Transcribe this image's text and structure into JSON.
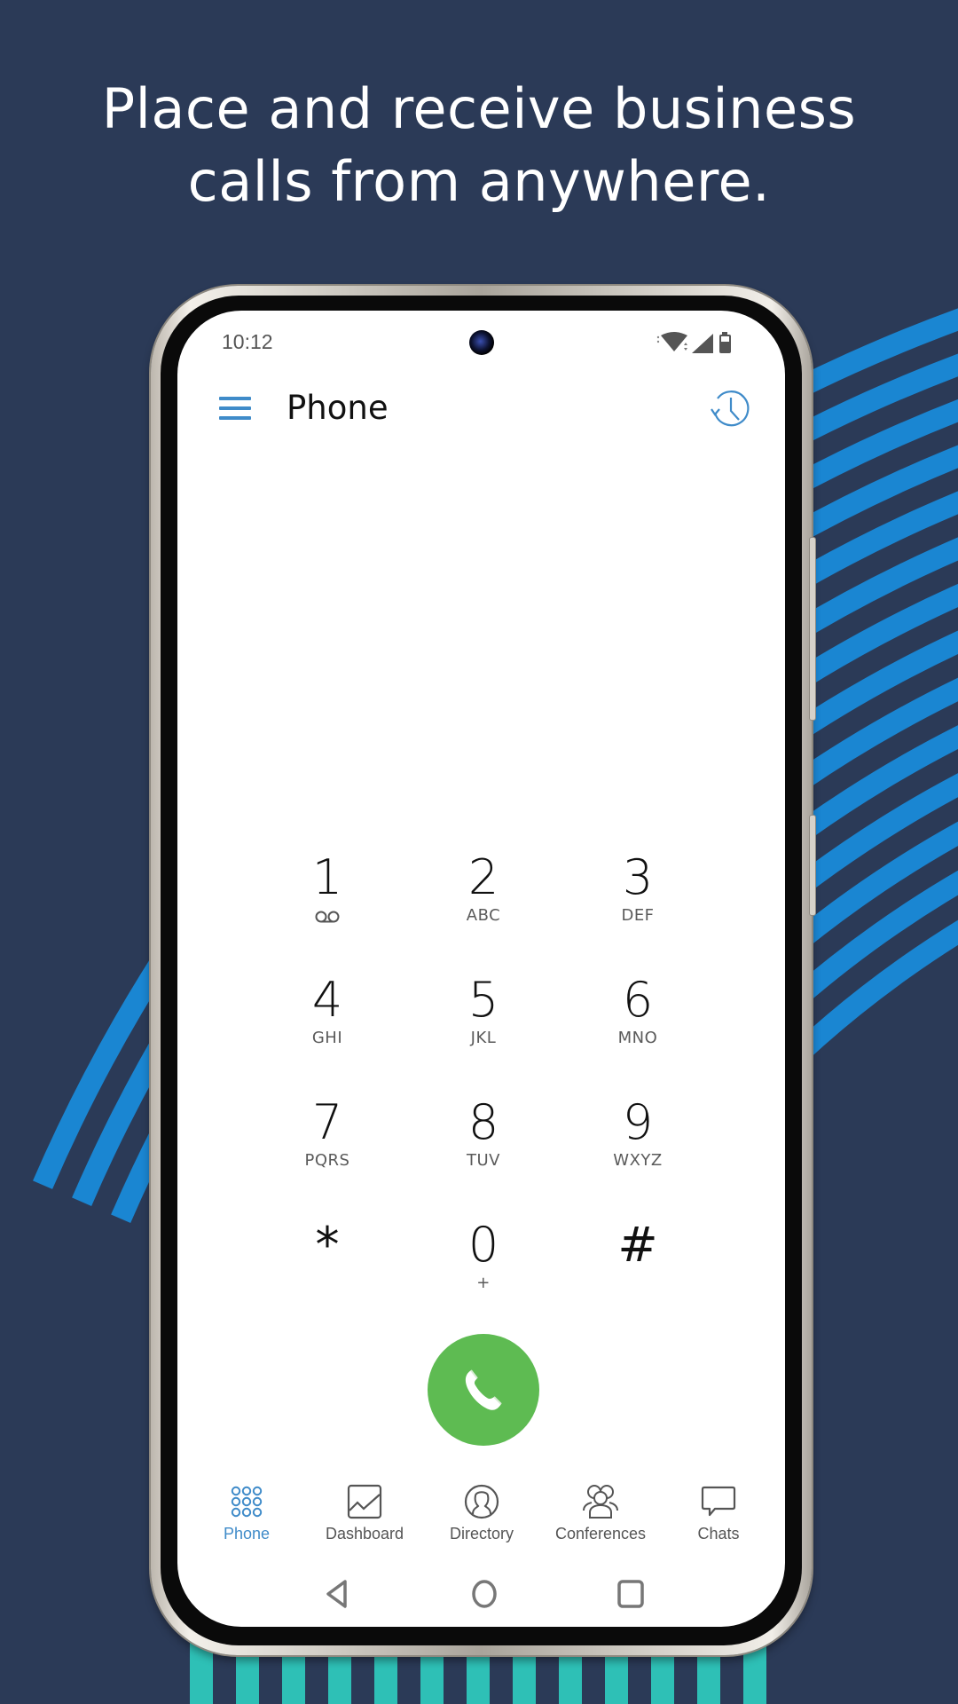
{
  "headline": {
    "line1": "Place and receive business",
    "line2": "calls from anywhere."
  },
  "colors": {
    "background": "#2b3a57",
    "arc_blue": "#1a86d2",
    "stripe_teal": "#2ec0b6",
    "accent_blue": "#3f8bc9",
    "call_green": "#5ebb52"
  },
  "status_bar": {
    "time": "10:12",
    "icons": [
      "wifi-icon",
      "cell-signal-icon",
      "battery-icon"
    ]
  },
  "app_bar": {
    "menu_icon": "hamburger-menu-icon",
    "title": "Phone",
    "history_icon": "call-history-icon"
  },
  "keypad": {
    "keys": [
      {
        "digit": "1",
        "letters": "",
        "sub_icon": "voicemail-icon"
      },
      {
        "digit": "2",
        "letters": "ABC"
      },
      {
        "digit": "3",
        "letters": "DEF"
      },
      {
        "digit": "4",
        "letters": "GHI"
      },
      {
        "digit": "5",
        "letters": "JKL"
      },
      {
        "digit": "6",
        "letters": "MNO"
      },
      {
        "digit": "7",
        "letters": "PQRS"
      },
      {
        "digit": "8",
        "letters": "TUV"
      },
      {
        "digit": "9",
        "letters": "WXYZ"
      },
      {
        "digit": "*",
        "letters": ""
      },
      {
        "digit": "0",
        "letters": "+"
      },
      {
        "digit": "#",
        "letters": ""
      }
    ],
    "call_icon": "phone-handset-icon"
  },
  "bottom_nav": {
    "items": [
      {
        "label": "Phone",
        "icon": "dialpad-icon",
        "active": true
      },
      {
        "label": "Dashboard",
        "icon": "chart-line-icon",
        "active": false
      },
      {
        "label": "Directory",
        "icon": "person-icon",
        "active": false
      },
      {
        "label": "Conferences",
        "icon": "group-icon",
        "active": false
      },
      {
        "label": "Chats",
        "icon": "chat-bubble-icon",
        "active": false
      }
    ]
  },
  "system_nav": {
    "back": "back-triangle-icon",
    "home": "home-circle-icon",
    "recents": "recents-square-icon"
  }
}
